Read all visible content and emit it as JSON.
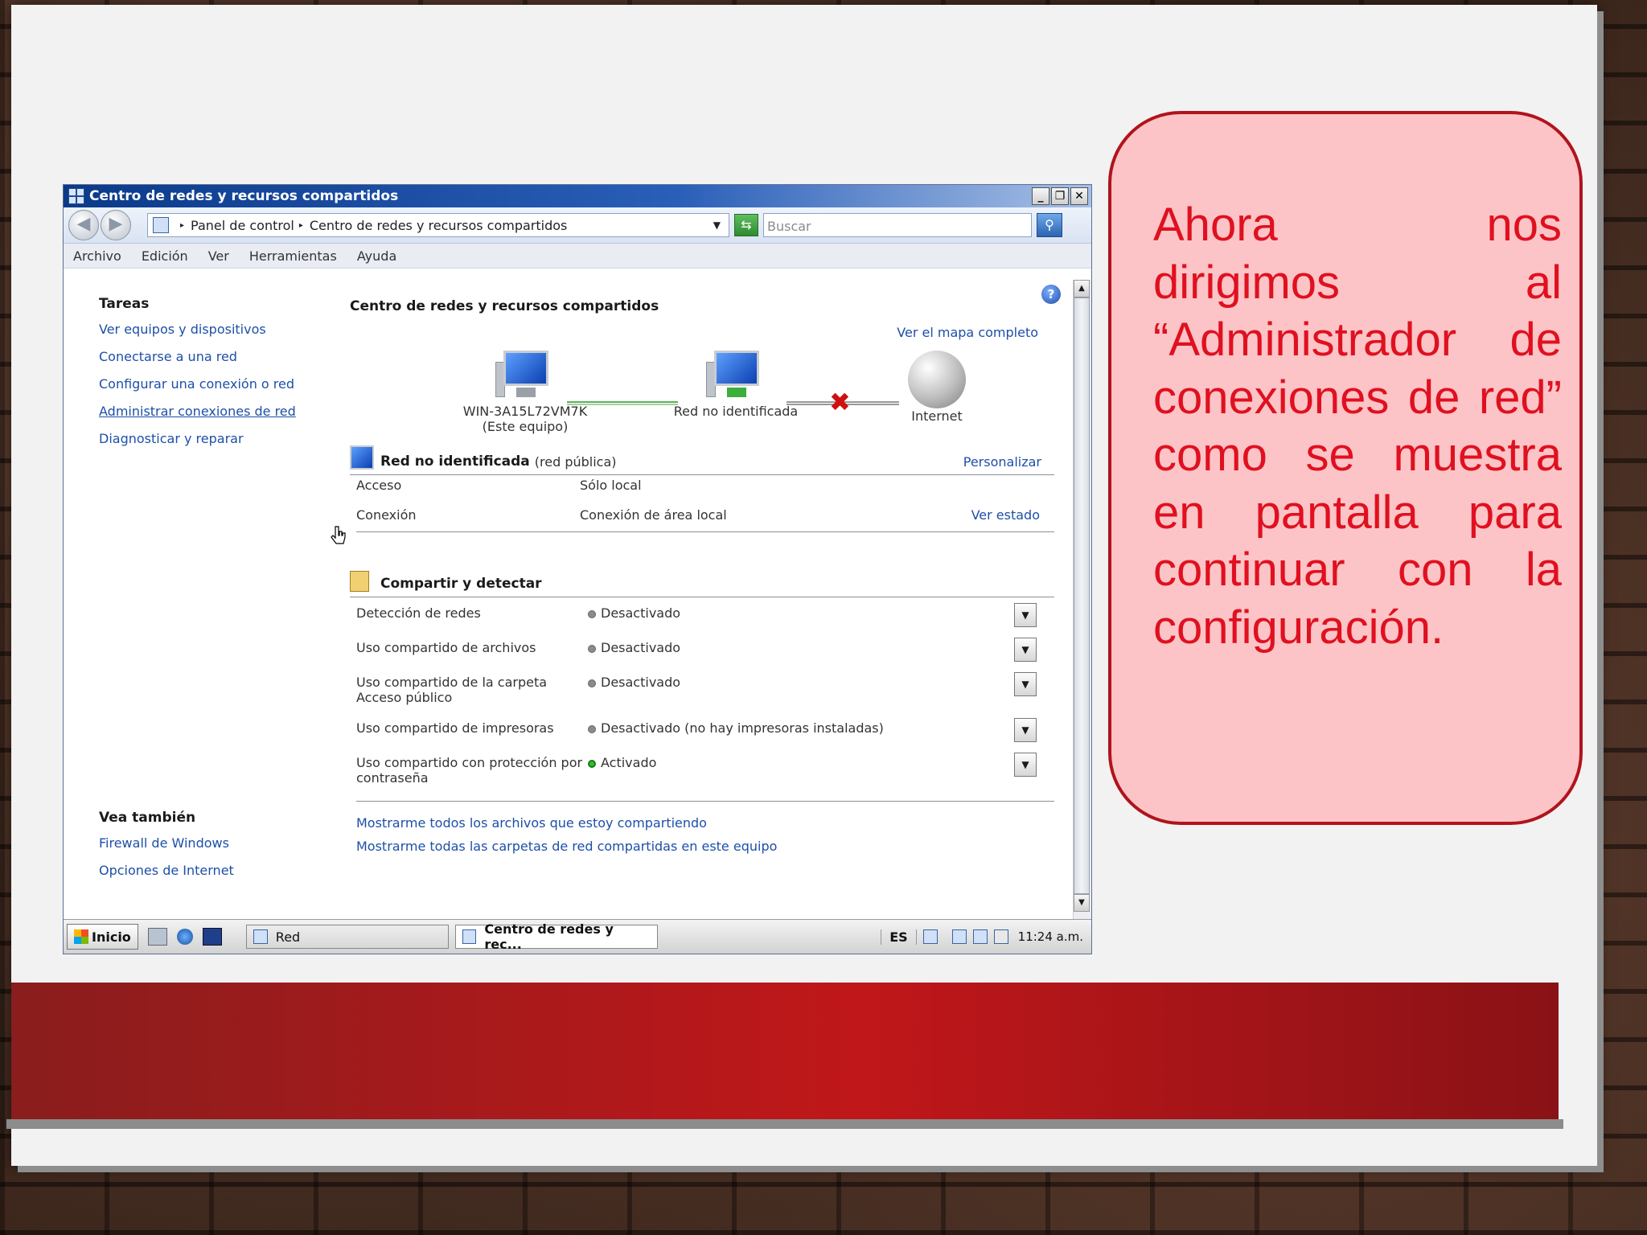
{
  "callout": {
    "text": "Ahora nos dirigimos al “Administrador de conexiones de red” como se muestra en pantalla para continuar con la configuración."
  },
  "window": {
    "title": "Centro de redes y recursos compartidos",
    "buttons": {
      "minimize": "_",
      "restore": "❐",
      "close": "✕"
    },
    "address": {
      "crumb1": "Panel de control",
      "crumb2": "Centro de redes y recursos compartidos"
    },
    "search": {
      "placeholder": "Buscar"
    },
    "menu": [
      "Archivo",
      "Edición",
      "Ver",
      "Herramientas",
      "Ayuda"
    ]
  },
  "sidebar": {
    "tasks_heading": "Tareas",
    "tasks": [
      "Ver equipos y dispositivos",
      "Conectarse a una red",
      "Configurar una conexión o red",
      "Administrar conexiones de red",
      "Diagnosticar y reparar"
    ],
    "see_also_heading": "Vea también",
    "see_also": [
      "Firewall de Windows",
      "Opciones de Internet"
    ]
  },
  "main": {
    "title": "Centro de redes y recursos compartidos",
    "map_link": "Ver el mapa completo",
    "map": {
      "computer_name": "WIN-3A15L72VM7K",
      "computer_sub": "(Este equipo)",
      "network": "Red no identificada",
      "internet": "Internet"
    },
    "network_section": {
      "name": "Red no identificada",
      "type": "(red pública)",
      "customize": "Personalizar",
      "rows": [
        {
          "label": "Acceso",
          "value": "Sólo local",
          "action": ""
        },
        {
          "label": "Conexión",
          "value": "Conexión de área local",
          "action": "Ver estado"
        }
      ]
    },
    "sharing_section": {
      "title": "Compartir y detectar",
      "rows": [
        {
          "label": "Detección de redes",
          "value": "Desactivado"
        },
        {
          "label": "Uso compartido de archivos",
          "value": "Desactivado"
        },
        {
          "label": "Uso compartido de la carpeta",
          "label2": "Acceso público",
          "value": "Desactivado"
        },
        {
          "label": "Uso compartido de impresoras",
          "value": "Desactivado (no hay impresoras instaladas)"
        },
        {
          "label": "Uso compartido con protección por",
          "label2": "contraseña",
          "value": "Activado"
        }
      ]
    },
    "bottom_links": [
      "Mostrarme todos los archivos que estoy compartiendo",
      "Mostrarme todas las carpetas de red compartidas en este equipo"
    ]
  },
  "taskbar": {
    "start": "Inicio",
    "items": [
      "Red",
      "Centro de redes y rec..."
    ],
    "lang": "ES",
    "clock": "11:24 a.m."
  },
  "colors": {
    "accent_red": "#c0171a",
    "callout_bg": "#fcc4c6",
    "link_blue": "#1d4fa8"
  }
}
